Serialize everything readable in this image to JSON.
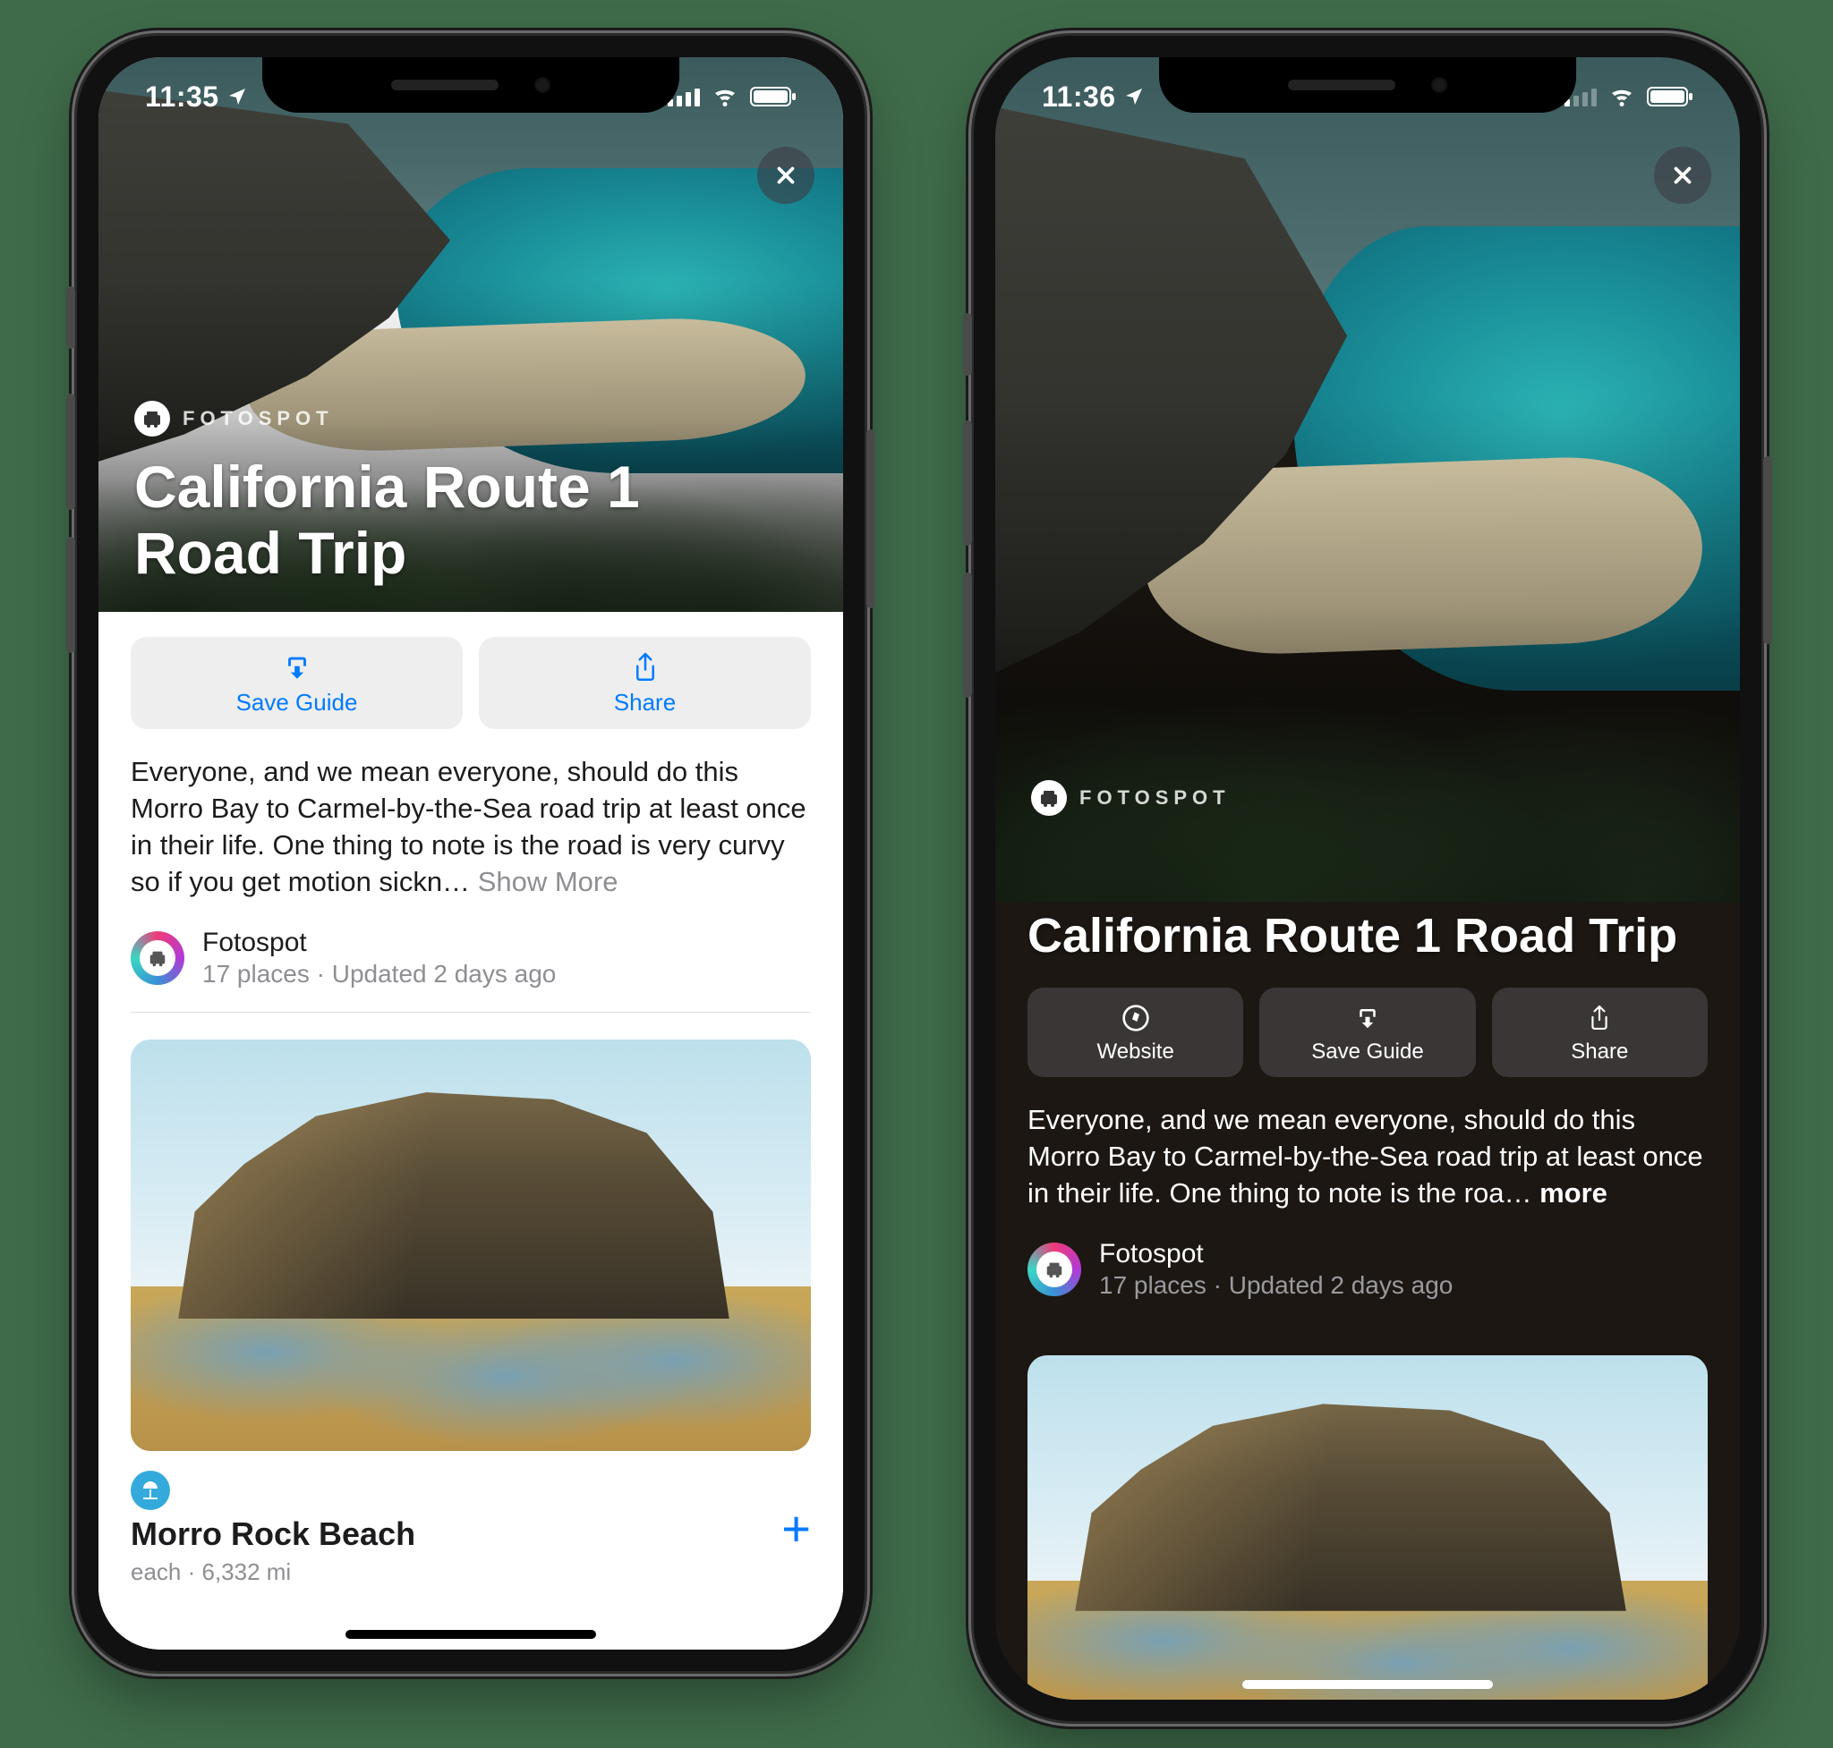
{
  "left_phone": {
    "status": {
      "time": "11:35"
    },
    "brand": "FOTOSPOT",
    "title": "California Route 1 Road Trip",
    "actions": {
      "save": "Save Guide",
      "share": "Share"
    },
    "description": "Everyone, and we mean everyone, should do this Morro Bay to Carmel-by-the-Sea road trip at least once in their life. One thing to note is the road is very curvy so if you get motion sickn…",
    "show_more": "Show More",
    "publisher": {
      "name": "Fotospot",
      "meta": "17 places · Updated 2 days ago"
    },
    "place": {
      "category_icon": "beach-umbrella",
      "title": "Morro Rock Beach",
      "subtitle": "each · 6,332 mi"
    }
  },
  "right_phone": {
    "status": {
      "time": "11:36"
    },
    "brand": "FOTOSPOT",
    "title": "California Route 1 Road Trip",
    "actions": {
      "website": "Website",
      "save": "Save Guide",
      "share": "Share"
    },
    "description": "Everyone, and we mean everyone, should do this Morro Bay to Carmel-by-the-Sea road trip at least once in their life. One thing to note is the roa…",
    "show_more": "more",
    "publisher": {
      "name": "Fotospot",
      "meta": "17 places · Updated 2 days ago"
    }
  }
}
